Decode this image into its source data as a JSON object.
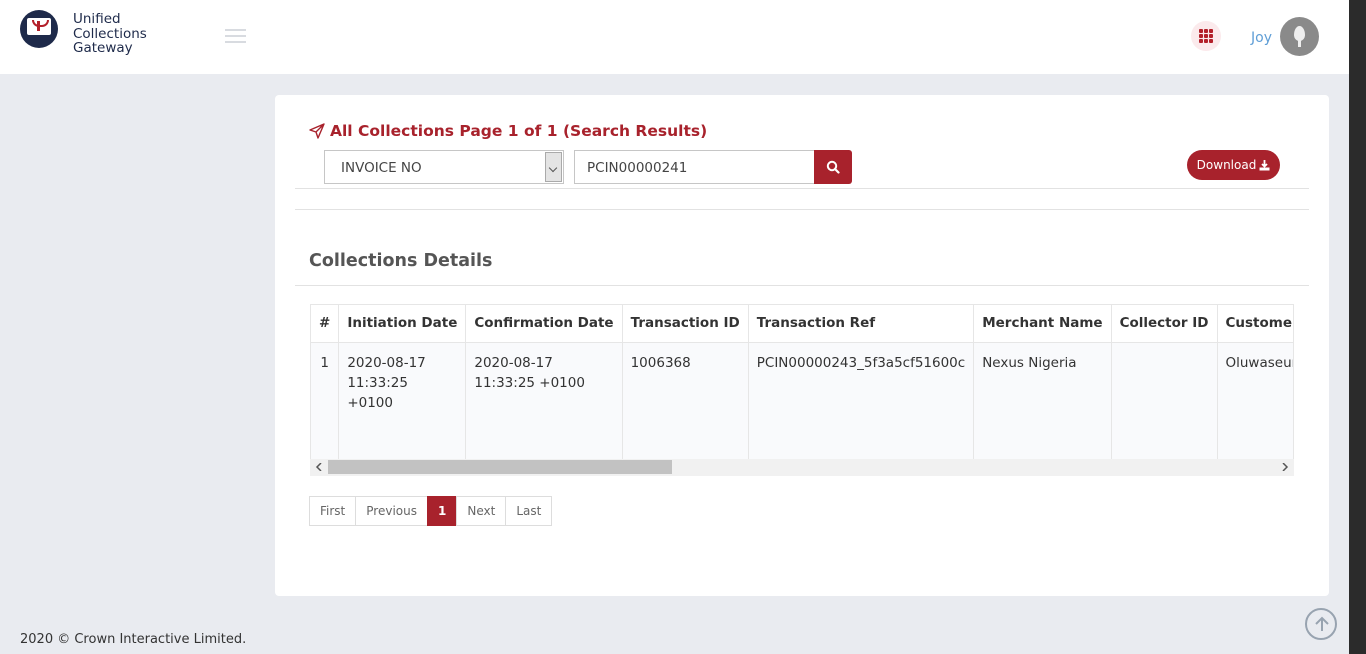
{
  "header": {
    "logo_lines": [
      "Unified",
      "Collections",
      "Gateway"
    ],
    "user_name": "Joy"
  },
  "card": {
    "title": "All Collections Page 1 of 1 (Search Results)",
    "filter_select": "INVOICE NO",
    "search_value": "PCIN00000241",
    "download_label": "Download"
  },
  "details": {
    "title": "Collections Details",
    "columns": [
      "#",
      "Initiation Date",
      "Confirmation Date",
      "Transaction ID",
      "Transaction Ref",
      "Merchant Name",
      "Collector ID",
      "Customer Name"
    ],
    "rows": [
      {
        "num": "1",
        "initiation_date": "2020-08-17 11:33:25 +0100",
        "confirmation_date": "2020-08-17 11:33:25 +0100",
        "transaction_id": "1006368",
        "transaction_ref": "PCIN00000243_5f3a5cf51600c",
        "merchant_name": "Nexus Nigeria",
        "collector_id": "",
        "customer_name": "Oluwaseun"
      }
    ]
  },
  "pager": {
    "first": "First",
    "previous": "Previous",
    "current": "1",
    "next": "Next",
    "last": "Last"
  },
  "footer": {
    "text": "2020 © Crown Interactive Limited."
  },
  "colors": {
    "brand_red": "#a8222c",
    "user_blue": "#5f9ed6"
  }
}
